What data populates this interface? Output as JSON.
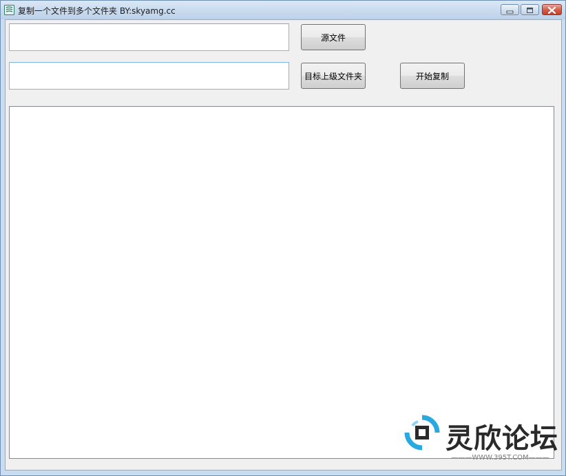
{
  "window": {
    "title": "复制一个文件到多个文件夹  BY:skyamg.cc",
    "icon": "app-stack-icon",
    "controls": [
      "minimize-icon",
      "maximize-icon",
      "close-icon"
    ]
  },
  "form": {
    "source_path": "",
    "target_path": "",
    "source_button": "源文件",
    "target_button": "目标上级文件夹",
    "start_button": "开始复制"
  },
  "watermark": {
    "brand": "灵欣论坛",
    "url": "———WWW.395T.COM———"
  },
  "colors": {
    "titlebar": "#c9dbef",
    "client_bg": "#f0f0f0",
    "close_red": "#c2412b",
    "watermark_blue": "#29a9e0"
  }
}
